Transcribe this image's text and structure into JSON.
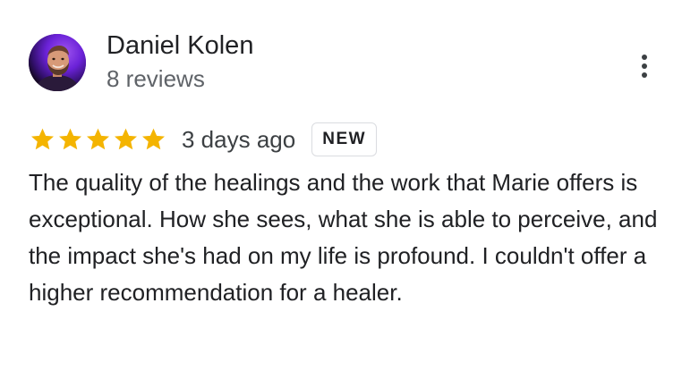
{
  "reviewer": {
    "name": "Daniel Kolen",
    "review_count": "8 reviews",
    "avatar_icon": "person-avatar"
  },
  "menu": {
    "icon": "more-vert-icon"
  },
  "rating": {
    "stars": 5,
    "max_stars": 5,
    "star_color": "#f4b400",
    "date": "3 days ago",
    "badge": "NEW"
  },
  "review": {
    "text": "The quality of the healings and the work that Marie offers is exceptional. How she sees, what she is able to perceive, and the impact she's had on my life is profound. I couldn't offer a higher recommendation for a healer."
  }
}
